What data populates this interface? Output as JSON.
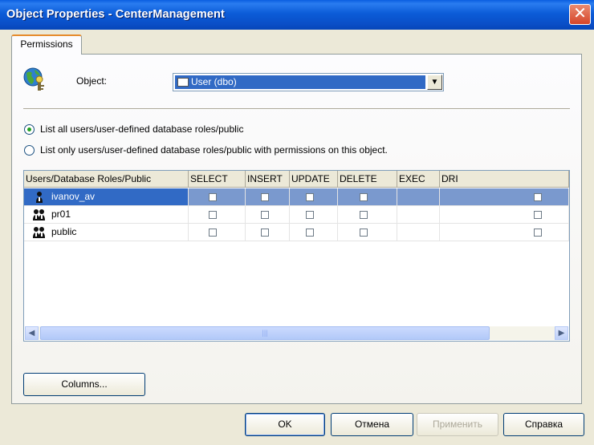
{
  "window": {
    "title": "Object Properties - CenterManagement",
    "close_icon": "close-icon"
  },
  "tabs": [
    {
      "label": "Permissions",
      "selected": true
    }
  ],
  "object": {
    "label": "Object:",
    "value": "User (dbo)"
  },
  "options": [
    {
      "label": "List all users/user-defined database roles/public",
      "selected": true
    },
    {
      "label": "List only users/user-defined database roles/public with permissions on this object.",
      "selected": false
    }
  ],
  "grid": {
    "columns": [
      "Users/Database Roles/Public",
      "SELECT",
      "INSERT",
      "UPDATE",
      "DELETE",
      "EXEC",
      "DRI"
    ],
    "rows": [
      {
        "name": "ivanov_av",
        "type": "user",
        "selected": true,
        "perms": [
          false,
          false,
          false,
          false,
          null,
          false
        ]
      },
      {
        "name": "pr01",
        "type": "role",
        "selected": false,
        "perms": [
          false,
          false,
          false,
          false,
          null,
          false
        ]
      },
      {
        "name": "public",
        "type": "role",
        "selected": false,
        "perms": [
          false,
          false,
          false,
          false,
          null,
          false
        ]
      }
    ]
  },
  "buttons": {
    "columns": "Columns...",
    "ok": "OK",
    "cancel": "Отмена",
    "apply": "Применить",
    "help": "Справка"
  },
  "colors": {
    "selection": "#316ac5",
    "titlebar": "#0a5ee0"
  }
}
